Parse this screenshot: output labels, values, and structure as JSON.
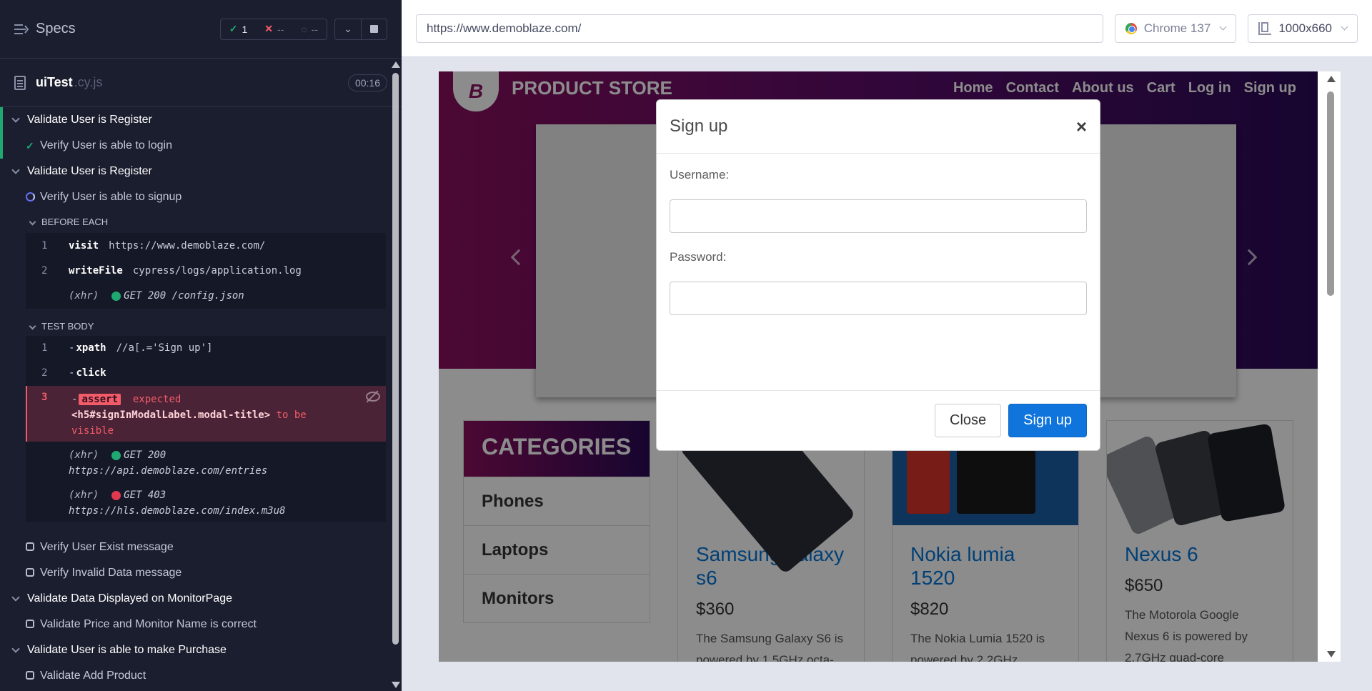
{
  "reporter": {
    "specs_label": "Specs",
    "stats": {
      "passed": "1",
      "failed": "--",
      "pending": "--"
    },
    "file": {
      "name": "uiTest",
      "ext": ".cy.js",
      "time": "00:16"
    },
    "tree": {
      "suite1": "Validate User is Register",
      "test1": "Verify User is able to login",
      "suite2": "Validate User is Register",
      "test2": "Verify User is able to signup",
      "before_each": "BEFORE EACH",
      "be_cmds": [
        {
          "num": "1",
          "name": "visit",
          "arg": "https://www.demoblaze.com/"
        },
        {
          "num": "2",
          "name": "writeFile",
          "arg": "cypress/logs/application.log"
        }
      ],
      "be_xhr": {
        "tag": "(xhr)",
        "req": "GET 200 /config.json"
      },
      "test_body": "TEST BODY",
      "tb_cmds": [
        {
          "num": "1",
          "name": "xpath",
          "arg": "//a[.='Sign up']"
        },
        {
          "num": "2",
          "name": "click",
          "arg": ""
        }
      ],
      "fail": {
        "num": "3",
        "badge": "assert",
        "expected": "expected",
        "selector": "<h5#signInModalLabel.modal-title>",
        "rest": "to be",
        "rest2": "visible"
      },
      "xhr1": {
        "tag": "(xhr)",
        "req": "GET 200",
        "url": "https://api.demoblaze.com/entries"
      },
      "xhr2": {
        "tag": "(xhr)",
        "req": "GET 403",
        "url": "https://hls.demoblaze.com/index.m3u8"
      },
      "test3": "Verify User Exist message",
      "test4": "Verify Invalid Data message",
      "suite3": "Validate Data Displayed on MonitorPage",
      "test5": "Validate Price and Monitor Name is correct",
      "suite4": "Validate User is able to make Purchase",
      "test6": "Validate Add Product"
    }
  },
  "aut": {
    "url": "https://www.demoblaze.com/",
    "browser": "Chrome 137",
    "viewport": "1000x660"
  },
  "site": {
    "brand": "PRODUCT STORE",
    "logo_letter": "B",
    "nav": [
      "Home",
      "Contact",
      "About us",
      "Cart",
      "Log in",
      "Sign up"
    ],
    "categories_title": "CATEGORIES",
    "categories": [
      "Phones",
      "Laptops",
      "Monitors"
    ],
    "products": [
      {
        "name": "Samsung galaxy s6",
        "price": "$360",
        "desc": "The Samsung Galaxy S6 is powered by 1.5GHz octa-"
      },
      {
        "name": "Nokia lumia 1520",
        "price": "$820",
        "desc": "The Nokia Lumia 1520 is powered by 2.2GHz"
      },
      {
        "name": "Nexus 6",
        "price": "$650",
        "desc": "The Motorola Google Nexus 6 is powered by 2.7GHz quad-core"
      }
    ],
    "modal": {
      "title": "Sign up",
      "close_x": "×",
      "username_label": "Username:",
      "password_label": "Password:",
      "close_btn": "Close",
      "signup_btn": "Sign up"
    }
  }
}
